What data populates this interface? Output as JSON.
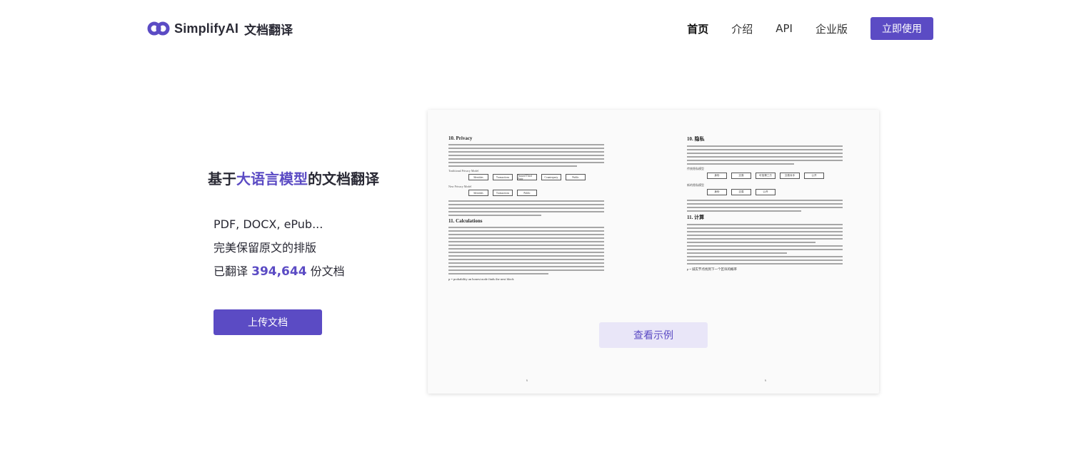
{
  "brand": {
    "name": "SimplifyAI",
    "subtitle": "文档翻译",
    "color": "#5b4bc4"
  },
  "nav": {
    "items": [
      "首页",
      "介绍",
      "API",
      "企业版"
    ],
    "cta": "立即使用"
  },
  "hero": {
    "title_pre": "基于",
    "title_highlight": "大语言模型",
    "title_post": "的文档翻译",
    "features": {
      "formats": "PDF, DOCX, ePub...",
      "layout": "完美保留原文的排版",
      "count_pre": "已翻译",
      "count": "394,644",
      "count_post": "份文档"
    },
    "upload": "上传文档"
  },
  "preview": {
    "left": {
      "sec1": "10.  Privacy",
      "diagram1_label": "Traditional Privacy Model",
      "diagram1": [
        "Identities",
        "Transactions",
        "Trusted Third Party",
        "Counterparty",
        "Public"
      ],
      "diagram2_label": "New Privacy Model",
      "diagram2": [
        "Identities",
        "Transactions",
        "Public"
      ],
      "sec2": "11.  Calculations",
      "formula": "p = probability an honest node finds the next block",
      "page": "6"
    },
    "right": {
      "sec1": "10. 隐私",
      "diagram1_label": "传统隐私模型",
      "diagram1": [
        "身份",
        "交易",
        "可信第三方",
        "交易对手",
        "公开"
      ],
      "diagram2_label": "新的隐私模型",
      "diagram2": [
        "身份",
        "交易",
        "公开"
      ],
      "sec2": "11. 计算",
      "formula": "p = 诚实节点找到下一个区块的概率",
      "page": "6"
    },
    "sample": "查看示例"
  }
}
